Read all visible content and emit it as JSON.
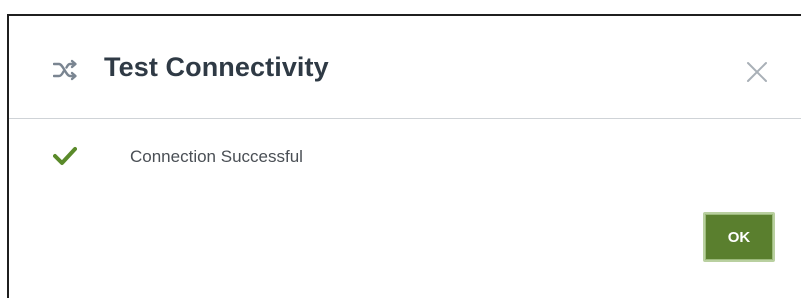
{
  "dialog": {
    "title": "Test Connectivity",
    "title_icon": "shuffle-icon",
    "close_icon": "close-icon",
    "status": {
      "icon": "checkmark-icon",
      "message": "Connection Successful",
      "icon_color": "#5a8a2a"
    },
    "ok_label": "OK",
    "ok_color": "#5a7f2e"
  }
}
